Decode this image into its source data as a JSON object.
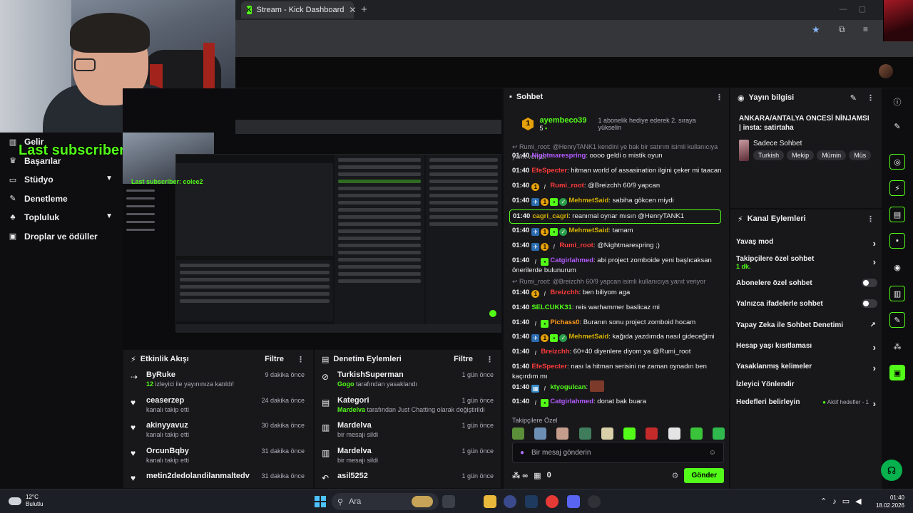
{
  "browser": {
    "tab_title": "Stream - Kick Dashboard",
    "tab_close": "✕",
    "new_tab": "+"
  },
  "overlay": {
    "last_subscriber": "Last subscriber: colee2"
  },
  "sidebar": {
    "items": [
      {
        "label": "Gelir",
        "icon": "chart-icon"
      },
      {
        "label": "Başarılar",
        "icon": "trophy-icon"
      },
      {
        "label": "Stüdyo",
        "icon": "studio-icon",
        "expandable": true
      },
      {
        "label": "Denetleme",
        "icon": "wrench-icon"
      },
      {
        "label": "Topluluk",
        "icon": "community-icon",
        "expandable": true
      },
      {
        "label": "Droplar ve ödüller",
        "icon": "gift-icon"
      }
    ]
  },
  "activity_feed": {
    "title": "Etkinlik Akışı",
    "filter_label": "Filtre",
    "items": [
      {
        "name": "ByRuke",
        "sub_highlight": "12",
        "sub": " izleyici ile yayınınıza katıldı!",
        "time": "9 dakika önce",
        "icon": "raid-icon"
      },
      {
        "name": "ceaserzep",
        "sub_highlight": "",
        "sub": "kanalı takip etti",
        "time": "24 dakika önce",
        "icon": "heart-icon"
      },
      {
        "name": "akinyyavuz",
        "sub_highlight": "",
        "sub": "kanalı takip etti",
        "time": "30 dakika önce",
        "icon": "heart-icon"
      },
      {
        "name": "OrcunBqby",
        "sub_highlight": "",
        "sub": "kanalı takip etti",
        "time": "31 dakika önce",
        "icon": "heart-icon"
      },
      {
        "name": "metin2dedolandilanmaltedv",
        "sub_highlight": "",
        "sub": "",
        "time": "31 dakika önce",
        "icon": "heart-icon"
      }
    ]
  },
  "mod_actions": {
    "title": "Denetim Eylemleri",
    "filter_label": "Filtre",
    "items": [
      {
        "name": "TurkishSuperman",
        "sub_highlight": "Gogo",
        "sub": " tarafından yasaklandı",
        "time": "1 gün önce",
        "icon": "ban-icon"
      },
      {
        "name": "Kategori",
        "sub_highlight": "Mardelva",
        "sub": " tarafından Just Chatting olarak değiştirildi",
        "time": "1 gün önce",
        "icon": "category-icon"
      },
      {
        "name": "Mardelva",
        "sub_highlight": "",
        "sub": "bir mesajı sildi",
        "time": "1 gün önce",
        "icon": "trash-icon"
      },
      {
        "name": "Mardelva",
        "sub_highlight": "",
        "sub": "bir mesajı sildi",
        "time": "1 gün önce",
        "icon": "trash-icon"
      },
      {
        "name": "asil5252",
        "sub_highlight": "",
        "sub": "",
        "time": "1 gün önce",
        "icon": "undo-icon"
      }
    ]
  },
  "chat": {
    "title": "Sohbet",
    "pinned": {
      "user": "ayembeco39",
      "rank": "1",
      "sub_count": "5",
      "message": "1 abonelik hediye ederek 2. sıraya yükselin"
    },
    "messages": [
      {
        "kind": "reply",
        "text": "Rumi_root: @HenryTANK1 kendini ye bak bir satırım isimli kullanıcıya yanıt veriyor"
      },
      {
        "time": "01:40",
        "user": "Nightmarespring",
        "color": "#b45cff",
        "badges": [],
        "text": ": oooo geldi o mistik oyun"
      },
      {
        "time": "01:40",
        "user": "EfeSpecter",
        "color": "#ff3b3b",
        "badges": [],
        "text": ": hitman world of assasination ilgini çeker mi taacan"
      },
      {
        "time": "01:40",
        "user": "Rumi_root",
        "color": "#ff3b3b",
        "badges": [
          "gold",
          "sw"
        ],
        "text": ": @Breizchh 60/9 yapcan"
      },
      {
        "time": "01:40",
        "user": "MehmetSaid",
        "color": "#d6b300",
        "badges": [
          "blue",
          "gold",
          "green",
          "gear"
        ],
        "text": ": sabiha gökcen miydi"
      },
      {
        "time": "01:40",
        "user": "cagri_cagri",
        "color": "#d6b300",
        "badges": [],
        "text": ": reanımal oynar mısın @HenryTANK1",
        "highlight": true
      },
      {
        "time": "01:40",
        "user": "MehmetSaid",
        "color": "#d6b300",
        "badges": [
          "blue",
          "gold",
          "green",
          "gear"
        ],
        "text": ": tamam"
      },
      {
        "time": "01:40",
        "user": "Rumi_root",
        "color": "#ff3b3b",
        "badges": [
          "blue",
          "gold",
          "sw"
        ],
        "text": ": @Nightmarespring ;)"
      },
      {
        "time": "01:40",
        "user": "Catgirlahmed",
        "color": "#b45cff",
        "badges": [
          "sw",
          "green"
        ],
        "text": ": abi project zomboide yeni başlıcaksan önerilerde bulunurum"
      },
      {
        "kind": "reply",
        "text": "Rumi_root: @Breizchh 60/9 yapcan isimli kullanıcıya yanıt veriyor"
      },
      {
        "time": "01:40",
        "user": "Breizchh",
        "color": "#ff3b3b",
        "badges": [
          "gold",
          "sw"
        ],
        "text": ": ben biliyom aga"
      },
      {
        "time": "01:40",
        "user": "SELCUKK31",
        "color": "#53fc18",
        "badges": [],
        "text": ": reis warhammer baslicaz mi"
      },
      {
        "time": "01:40",
        "user": "Pichass0",
        "color": "#ff9a1a",
        "badges": [
          "sw",
          "green"
        ],
        "text": ": Buranın sonu project zomboid hocam"
      },
      {
        "time": "01:40",
        "user": "MehmetSaid",
        "color": "#d6b300",
        "badges": [
          "blue",
          "gold",
          "green",
          "gear"
        ],
        "text": ": kağıda yazdımda nasıl gideceğimi"
      },
      {
        "time": "01:40",
        "user": "Breizchh",
        "color": "#ff3b3b",
        "badges": [
          "sw"
        ],
        "text": ": 60+40 diyenlere diyom ya @Rumi_root"
      },
      {
        "time": "01:40",
        "user": "EfeSpecter",
        "color": "#ff3b3b",
        "badges": [],
        "text": ": nası la hitman serisini ne zaman oynadın ben kaçırdım mı"
      },
      {
        "time": "01:40",
        "user": "ktyogulcan",
        "color": "#53fc18",
        "badges": [
          "tl",
          "sw"
        ],
        "text": ":",
        "emote": true
      },
      {
        "time": "01:40",
        "user": "Catgirlahmed",
        "color": "#b45cff",
        "badges": [
          "sw",
          "green"
        ],
        "text": ": donat bak buara"
      }
    ],
    "followers_only_label": "Takipçilere Özel",
    "input_placeholder": "Bir mesaj gönderin",
    "points": "0",
    "send_label": "Gönder"
  },
  "stream_info": {
    "title": "Yayın bilgisi",
    "stream_title": "ANKARA/ANTALYA ONCESİ NİNJAMSI | insta: satirtaha",
    "category": "Sadece Sohbet",
    "tags": [
      "Turkish",
      "Mekip",
      "Mümin",
      "Müs"
    ]
  },
  "channel_actions": {
    "title": "Kanal Eylemleri",
    "items": [
      {
        "label": "Yavaş mod",
        "type": "chevron",
        "sub": ""
      },
      {
        "label": "Takipçilere özel sohbet",
        "type": "chevron",
        "sub": "1 dk."
      },
      {
        "label": "Abonelere özel sohbet",
        "type": "toggle",
        "sub": ""
      },
      {
        "label": "Yalnızca ifadelerle sohbet",
        "type": "toggle",
        "sub": ""
      },
      {
        "label": "Yapay Zeka ile Sohbet Denetimi",
        "type": "external",
        "sub": ""
      },
      {
        "label": "Hesap yaşı kısıtlaması",
        "type": "chevron",
        "sub": ""
      },
      {
        "label": "Yasaklanmış kelimeler",
        "type": "chevron",
        "sub": ""
      },
      {
        "label": "İzleyici Yönlendir",
        "type": "none",
        "sub": ""
      },
      {
        "label": "Hedefleri belirleyin",
        "type": "goal",
        "sub": "",
        "goal": "Aktif hedefler - 1"
      }
    ]
  },
  "taskbar": {
    "temperature": "12°C",
    "weather": "Bulutlu",
    "search_placeholder": "Ara",
    "time": "01:40",
    "date": "18.02.2026"
  },
  "colors": {
    "accent": "#53fc18",
    "panel": "#18181b",
    "background": "#0e0e10"
  }
}
